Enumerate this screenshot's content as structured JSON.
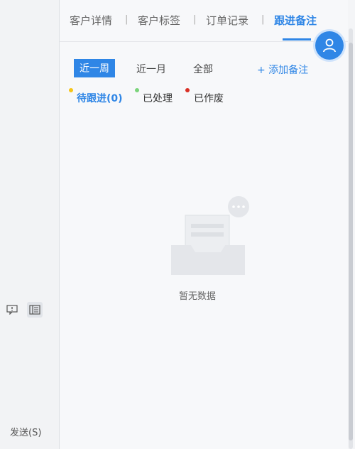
{
  "tabs": [
    "客户详情",
    "客户标签",
    "订单记录",
    "跟进备注"
  ],
  "filters": [
    "近一周",
    "近一月",
    "全部"
  ],
  "add_note": "+ 添加备注",
  "status": {
    "pending": "待跟进(0)",
    "done": "已处理",
    "void": "已作废"
  },
  "empty_text": "暂无数据",
  "send": "发送(S)",
  "colors": {
    "accent": "#2f86e6",
    "pending_dot": "#f5c518",
    "done_dot": "#7bd47b",
    "void_dot": "#d93025"
  }
}
